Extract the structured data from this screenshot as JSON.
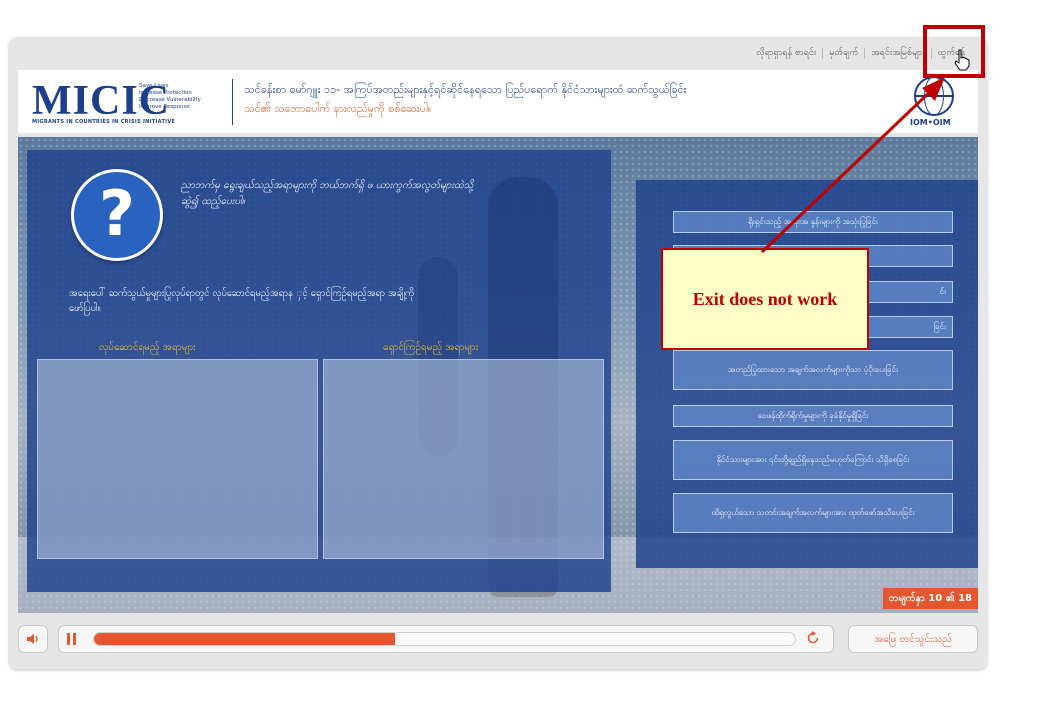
{
  "topnav": {
    "items": [
      "လိုရာရှာရန် စာရင်း",
      "မှတ်ချက်",
      "အရင်းအမြစ်များ",
      "ထွက်ရန်"
    ]
  },
  "header": {
    "logo_text": "MICIC",
    "logo_lines": [
      "Save Lives",
      "Increase Protection",
      "Decrease Vulnerability",
      "Improve Response"
    ],
    "logo_sub": "MIGRANTS IN COUNTRIES IN CRISIS INITIATIVE",
    "title": "သင်ခန်းစာ မော်ဂျူး ၁၁- အကြပ်အတည်းများနှင့်ရင်ဆိုင်နေရသော ပြည်ပရောက် နိုင်ငံသားများထံ ဆက်သွယ်ခြင်း",
    "subtitle": "သင်၏ သဘောပေါက် နားလည်မှုကို စစ်ဆေးပါ။",
    "org_label": "IOM•OIM"
  },
  "activity": {
    "question_mark": "?",
    "instruction_top": "ညာဘက်မှ ရွေးချယ်သည့်အရာများကို ဘယ်ဘက်ရှိ ဖ ယားကွက်အလွတ်များထဲသို့ ဆွဲ၍ ထည့်ပေးပါ။",
    "instruction_mid": "အရေးပေါ် ဆက်သွယ်မှုများပြုလုပ်ရာတွင် လုပ်ဆောင်ရမည့်အရာန ှင့် ရှောင်ကြဉ်ရမည့်အရာ အချို့ကို ဖော်ပြပါ။",
    "col_do": "လုပ်ဆောင်ရမည့် အရာများ",
    "col_avoid": "ရှောင်ကြဉ်ရမည့် အရာများ",
    "options": [
      "ရိုးရှင်းသည့် အသုံးအ နှုန်းများကို အသုံးပြုခြင်း",
      "",
      "င်း",
      "ခြင်း",
      "အတည်ပြုထားသော အချက်အလက်များကိုသာ ပံ့ပိုးပေးခြင်း",
      "ဝေဖန်ထိုက်ရိုက်မှုများကို ခုခံနိုင်မှုရှိခြင်း",
      "နိုင်ငံသားများအား ၎င်းတို့ချည်ရှိနေသည်မဟုတ်ကြောင်း သိရှိစေခြင်း",
      "ထိရှလွယ်သော သတင်းအချက်အလက်များအား ထုတ်ဖော်အသိပေးခြင်း"
    ],
    "counter": "တမျက်နှာ 10 ၏ 18"
  },
  "callout": {
    "text": "Exit does not work"
  },
  "controls": {
    "mute_icon": "speaker-icon",
    "pause_icon": "pause-icon",
    "progress_fraction": 0.43,
    "replay_icon": "replay-icon",
    "submit_label": "အဖြေ တင်သွင်းသည်"
  },
  "colors": {
    "brand_blue": "#1c3f8c",
    "accent_orange": "#e4572e",
    "annotation_red": "#c00000"
  }
}
